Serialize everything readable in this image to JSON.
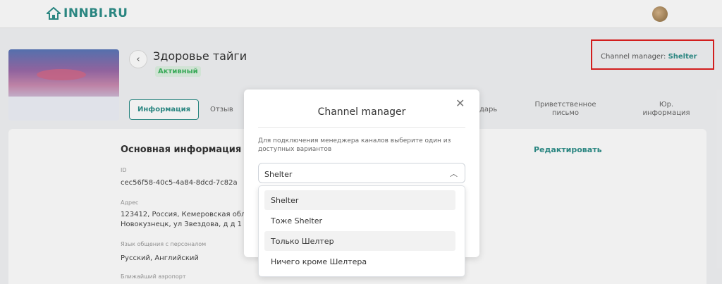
{
  "header": {
    "logo_text": "INNBI.RU"
  },
  "hotel": {
    "name": "Здоровье тайги",
    "status": "Активный"
  },
  "channel_manager": {
    "label": "Channel manager:",
    "value": "Shelter"
  },
  "tabs": [
    {
      "label": "Информация"
    },
    {
      "label": "Отзыв"
    },
    {
      "label": "дарь"
    },
    {
      "label": "Приветственное письмо"
    },
    {
      "label": "Юр. информация"
    }
  ],
  "section": {
    "title": "Основная информация",
    "edit_label": "Редактировать",
    "fields": [
      {
        "label": "ID",
        "value": "cec56f58-40c5-4a84-8dcd-7c82a"
      },
      {
        "label": "Адрес",
        "value": "123412, Россия, Кемеровская обл",
        "value2": "Новокузнецк, ул Звездова, д д 1"
      },
      {
        "label": "Язык общения с персоналом",
        "value": "Русский, Английский"
      },
      {
        "label": "Ближайший аэропорт",
        "value": ""
      }
    ]
  },
  "modal": {
    "title": "Channel manager",
    "description": "Для подключения менеджера каналов выберите один из доступных вариантов",
    "selected": "Shelter",
    "options": [
      "Shelter",
      "Тоже Shelter",
      "Только Шелтер",
      "Ничего кроме Шелтера"
    ]
  },
  "icons": {
    "logo": "home-icon",
    "back": "chevron-left-icon",
    "close": "close-icon",
    "select": "chevron-up-icon"
  },
  "colors": {
    "accent": "#2e8f8a",
    "highlight_border": "#e02020",
    "status": "#3db45e"
  }
}
